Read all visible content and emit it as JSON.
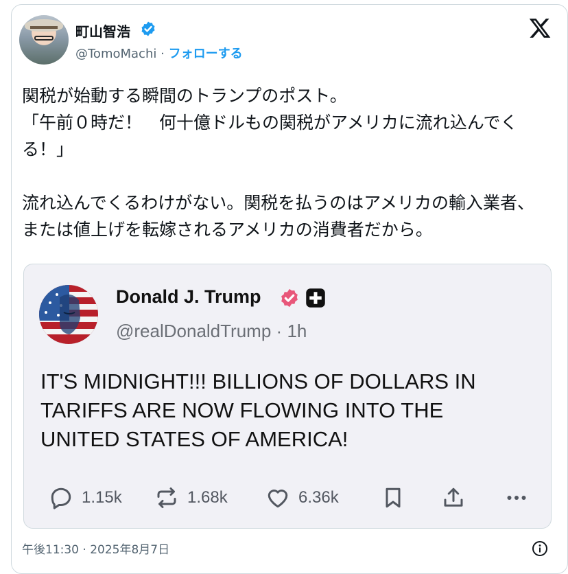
{
  "author": {
    "name": "町山智浩",
    "handle": "@TomoMachi",
    "separator": "·",
    "follow_label": "フォローする"
  },
  "post": {
    "text": "関税が始動する瞬間のトランプのポスト。\n「午前０時だ！　何十億ドルもの関税がアメリカに流れ込んでくる！」\n\n流れ込んでくるわけがない。関税を払うのはアメリカの輸入業者、または値上げを転嫁されるアメリカの消費者だから。"
  },
  "quoted": {
    "name": "Donald J. Trump",
    "handle": "@realDonaldTrump",
    "separator": "·",
    "time": "1h",
    "text": "IT'S MIDNIGHT!!! BILLIONS OF DOLLARS IN\nTARIFFS ARE NOW FLOWING INTO THE\nUNITED STATES OF AMERICA!",
    "actions": {
      "replies": "1.15k",
      "reposts": "1.68k",
      "likes": "6.36k"
    }
  },
  "footer": {
    "timestamp": "午後11:30 · 2025年8月7日"
  },
  "colors": {
    "accent": "#1d9bf0",
    "truth_badge": "#e8577a",
    "text": "#0f1419",
    "muted": "#536471"
  },
  "icons": [
    "x-logo-icon",
    "verified-badge-icon",
    "truth-verified-badge-icon",
    "plus-icon",
    "reply-icon",
    "repost-icon",
    "like-icon",
    "bookmark-icon",
    "share-icon",
    "more-icon",
    "info-icon"
  ]
}
